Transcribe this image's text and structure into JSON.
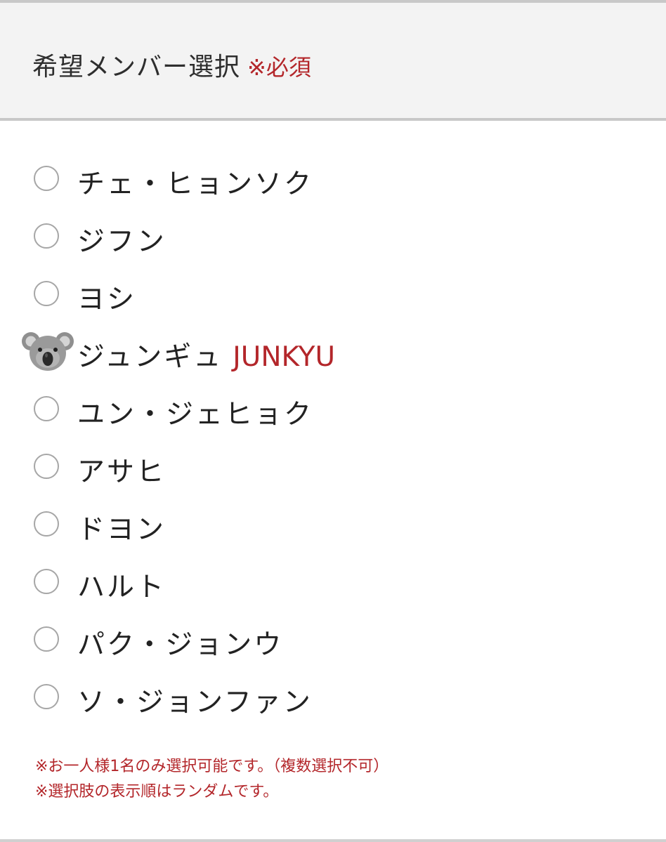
{
  "header": {
    "title": "希望メンバー選択",
    "required": "※必須"
  },
  "options": [
    {
      "label": "チェ・ヒョンソク",
      "selected": false,
      "icon": "radio-icon"
    },
    {
      "label": "ジフン",
      "selected": false,
      "icon": "radio-icon"
    },
    {
      "label": "ヨシ",
      "selected": false,
      "icon": "radio-icon"
    },
    {
      "label": "ジュンギュ",
      "latin": "JUNKYU",
      "selected": true,
      "icon": "koala-icon"
    },
    {
      "label": "ユン・ジェヒョク",
      "selected": false,
      "icon": "radio-icon"
    },
    {
      "label": "アサヒ",
      "selected": false,
      "icon": "radio-icon"
    },
    {
      "label": "ドヨン",
      "selected": false,
      "icon": "radio-icon"
    },
    {
      "label": "ハルト",
      "selected": false,
      "icon": "radio-icon"
    },
    {
      "label": "パク・ジョンウ",
      "selected": false,
      "icon": "radio-icon"
    },
    {
      "label": "ソ・ジョンファン",
      "selected": false,
      "icon": "radio-icon"
    }
  ],
  "notes": [
    "※お一人様1名のみ選択可能です。（複数選択不可）",
    "※選択肢の表示順はランダムです。"
  ],
  "colors": {
    "accent_red": "#b3262a",
    "header_bg": "#f3f3f3",
    "border_gray": "#c8c8c8",
    "radio_gray": "#a6a6a6",
    "text": "#222222"
  }
}
